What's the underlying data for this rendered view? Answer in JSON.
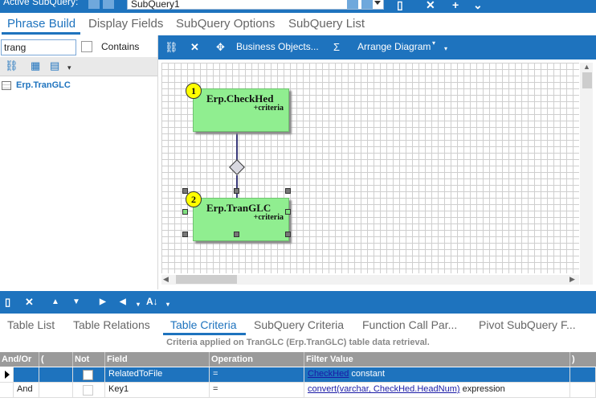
{
  "topbar": {
    "label": "Active SubQuery:",
    "subquery_value": "SubQuery1"
  },
  "main_tabs": [
    {
      "label": "Phrase Build",
      "active": true
    },
    {
      "label": "Display Fields",
      "active": false
    },
    {
      "label": "SubQuery Options",
      "active": false
    },
    {
      "label": "SubQuery List",
      "active": false
    }
  ],
  "left_panel": {
    "search_value": "trang",
    "contains_label": "Contains",
    "contains_checked": false,
    "tree_items": [
      "Erp.TranGLC"
    ]
  },
  "diagram_toolbar": {
    "business_objects_label": "Business Objects...",
    "sigma": "Σ",
    "arrange_label": "Arrange Diagram"
  },
  "diagram": {
    "tables": [
      {
        "number": "1",
        "name": "Erp.CheckHed",
        "criteria": "+criteria",
        "selected": false
      },
      {
        "number": "2",
        "name": "Erp.TranGLC",
        "criteria": "+criteria",
        "selected": true
      }
    ]
  },
  "bottom_tabs": [
    {
      "label": "Table List",
      "active": false
    },
    {
      "label": "Table Relations",
      "active": false
    },
    {
      "label": "Table Criteria",
      "active": true
    },
    {
      "label": "SubQuery Criteria",
      "active": false
    },
    {
      "label": "Function Call Par...",
      "active": false
    },
    {
      "label": "Pivot SubQuery F...",
      "active": false
    }
  ],
  "criteria_caption": "Criteria applied on TranGLC (Erp.TranGLC)  table data retrieval.",
  "criteria_grid": {
    "columns": [
      "And/Or",
      "(",
      "Not",
      "Field",
      "Operation",
      "Filter Value",
      ")"
    ],
    "rows": [
      {
        "and_or": "",
        "open": "",
        "not": false,
        "field": "RelatedToFile",
        "operation": "=",
        "filter_link": "CheckHed",
        "filter_text": "constant",
        "close": "",
        "selected": true
      },
      {
        "and_or": "And",
        "open": "",
        "not": false,
        "field": "Key1",
        "operation": "=",
        "filter_link": "convert(varchar, CheckHed.HeadNum)",
        "filter_text": "expression",
        "close": "",
        "selected": false
      }
    ]
  },
  "colors": {
    "accent": "#1e73be",
    "table_box": "#90ee90",
    "badge": "#ffff00"
  }
}
